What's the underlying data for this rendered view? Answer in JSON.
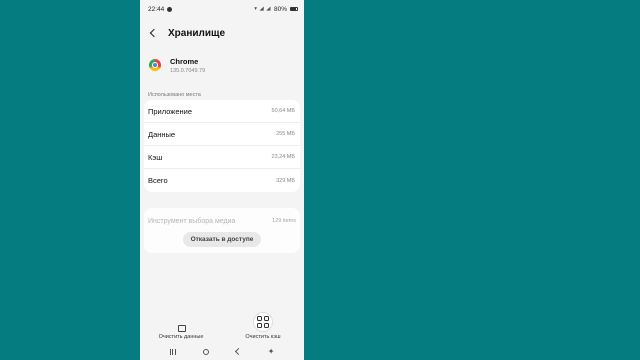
{
  "status_bar": {
    "time": "22:44",
    "battery": "80%"
  },
  "header": {
    "title": "Хранилище"
  },
  "app": {
    "name": "Chrome",
    "version": "135.0.7049.79"
  },
  "usage": {
    "section_label": "Использовано места",
    "rows": [
      {
        "label": "Приложение",
        "value": "50,64 МБ"
      },
      {
        "label": "Данные",
        "value": "255 МБ"
      },
      {
        "label": "Кэш",
        "value": "23,24 МБ"
      },
      {
        "label": "Всего",
        "value": "329 МБ"
      }
    ]
  },
  "media": {
    "label": "Инструмент выбора медиа",
    "count": "129 items",
    "revoke_button": "Отказать в доступе"
  },
  "bottom_actions": {
    "clear_data": "Очистить данные",
    "clear_cache": "Очистить кэш"
  },
  "icons": [
    "back-icon",
    "chrome-icon",
    "clear-data-icon",
    "clear-cache-icon",
    "recent-apps-icon",
    "home-icon",
    "nav-back-icon",
    "accessibility-icon"
  ],
  "colors": {
    "background": "#047c80",
    "screen": "#f4f4f4"
  }
}
